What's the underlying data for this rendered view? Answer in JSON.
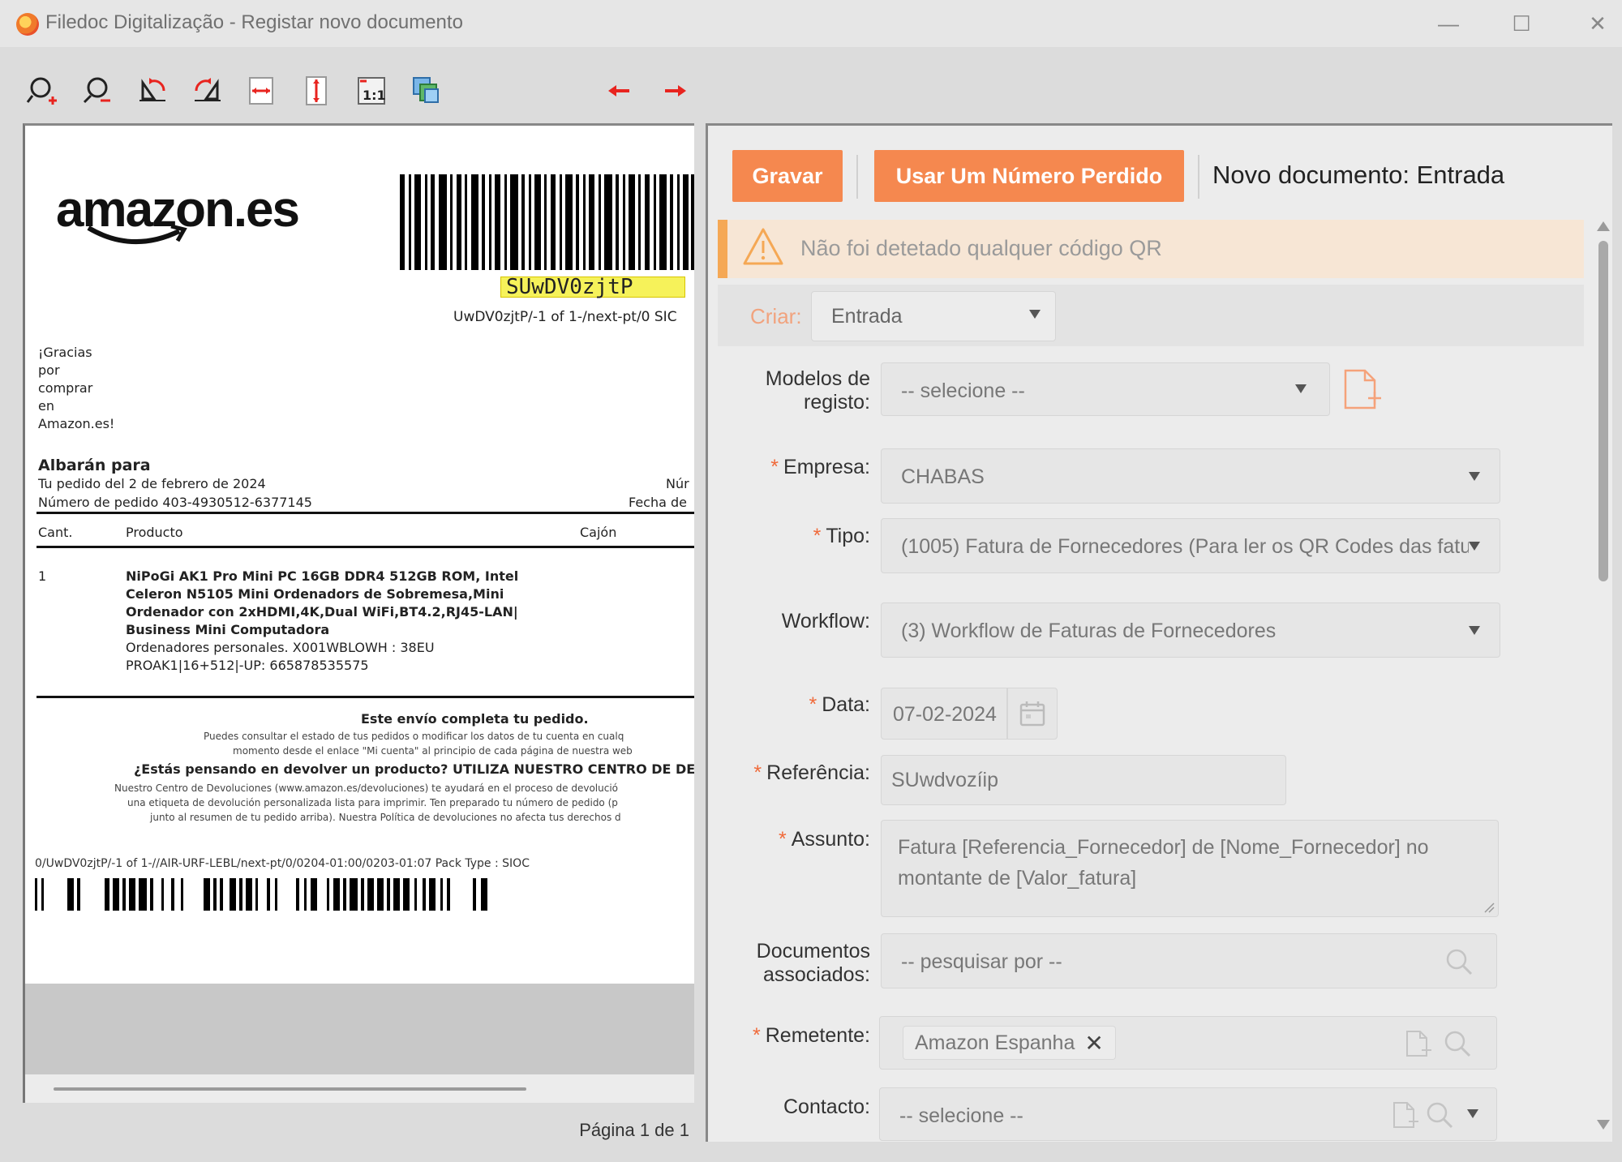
{
  "window": {
    "title": "Filedoc Digitalização - Registar novo documento",
    "minimize": "—",
    "maximize": "☐",
    "close": "✕"
  },
  "toolbar": {
    "items": [
      "zoom-in-icon",
      "zoom-out-icon",
      "rotate-left-icon",
      "rotate-right-icon",
      "fit-width-icon",
      "fit-height-icon",
      "actual-size-icon",
      "pages-icon"
    ],
    "prev_page": "prev-arrow-icon",
    "next_page": "next-arrow-icon",
    "accent": "#e8241f"
  },
  "preview": {
    "pager": "Página 1 de 1",
    "document": {
      "logo": "amazon.es",
      "code": "SUwDV0zjtP",
      "tracking_top": "UwDV0zjtP/-1 of 1-/next-pt/0 SIC",
      "thanks": [
        "¡Gracias",
        "por",
        "comprar",
        "en",
        "Amazon.es!"
      ],
      "albaran_title": "Albarán para",
      "order_date": "Tu pedido del 2 de febrero de 2024",
      "order_number": "Número de pedido 403-4930512-6377145",
      "right_num": "Núr",
      "right_fecha": "Fecha de",
      "col_cant": "Cant.",
      "col_producto": "Producto",
      "col_cajon": "Cajón",
      "item_qty": "1",
      "item_lines": [
        "NiPoGi AK1 Pro Mini PC 16GB DDR4 512GB ROM, Intel",
        "Celeron N5105 Mini Ordenadors de Sobremesa,Mini",
        "Ordenador con 2xHDMI,4K,Dual WiFi,BT4.2,RJ45-LAN|",
        "Business Mini Computadora"
      ],
      "item_meta_1": "Ordenadores personales. X001WBLOWH : 38EU",
      "item_meta_2": "PROAK1|16+512|-UP: 665878535575",
      "complete": "Este envío completa tu pedido.",
      "fine_1": "Puedes consultar el estado de tus pedidos o modificar los datos de tu cuenta en cualq",
      "fine_2": "momento desde el enlace \"Mi cuenta\" al principio de cada página de nuestra web",
      "return_q": "¿Estás pensando en devolver un producto? UTILIZA NUESTRO CENTRO DE DEVOLUCIO",
      "fine_3": "Nuestro Centro de Devoluciones (www.amazon.es/devoluciones) te ayudará en el proceso de devolució",
      "fine_4": "una etiqueta de devolución personalizada lista para imprimir. Ten preparado tu número de pedido (p",
      "fine_5": "junto al resumen de tu pedido arriba). Nuestra Política de devoluciones no afecta tus derechos d",
      "tracking_bottom": "0/UwDV0zjtP/-1 of 1-//AIR-URF-LEBL/next-pt/0/0204-01:00/0203-01:07 Pack Type : SIOC"
    }
  },
  "form": {
    "buttons": {
      "save": "Gravar",
      "use_lost_number": "Usar Um Número Perdido"
    },
    "doc_state": "Novo documento: Entrada",
    "alert": "Não foi detetado qualquer código QR",
    "criar": {
      "label": "Criar:",
      "value": "Entrada"
    },
    "required_mark": "*",
    "fields": {
      "modelos": {
        "label_1": "Modelos de",
        "label_2": "registo:",
        "value": "-- selecione --"
      },
      "empresa": {
        "label": "Empresa:",
        "value": "CHABAS"
      },
      "tipo": {
        "label": "Tipo:",
        "value": "(1005) Fatura de Fornecedores (Para ler os QR Codes das fatu..."
      },
      "workflow": {
        "label": "Workflow:",
        "value": "(3) Workflow de Faturas de Fornecedores"
      },
      "data": {
        "label": "Data:",
        "value": "07-02-2024"
      },
      "referencia": {
        "label": "Referência:",
        "value": "SUwdvozíip"
      },
      "assunto": {
        "label": "Assunto:",
        "value_1": "Fatura [Referencia_Fornecedor] de [Nome_Fornecedor] no",
        "value_2": "montante de [Valor_fatura]"
      },
      "documentos": {
        "label_1": "Documentos",
        "label_2": "associados:",
        "placeholder": "-- pesquisar por --"
      },
      "remetente": {
        "label": "Remetente:",
        "tag": "Amazon Espanha",
        "tag_remove": "✕"
      },
      "contacto": {
        "label": "Contacto:",
        "value": "-- selecione --"
      }
    },
    "colors": {
      "button": "#f5884f",
      "required": "#f06a3a",
      "alert_bg": "#f7e6d5",
      "alert_border": "#f5a855"
    }
  }
}
